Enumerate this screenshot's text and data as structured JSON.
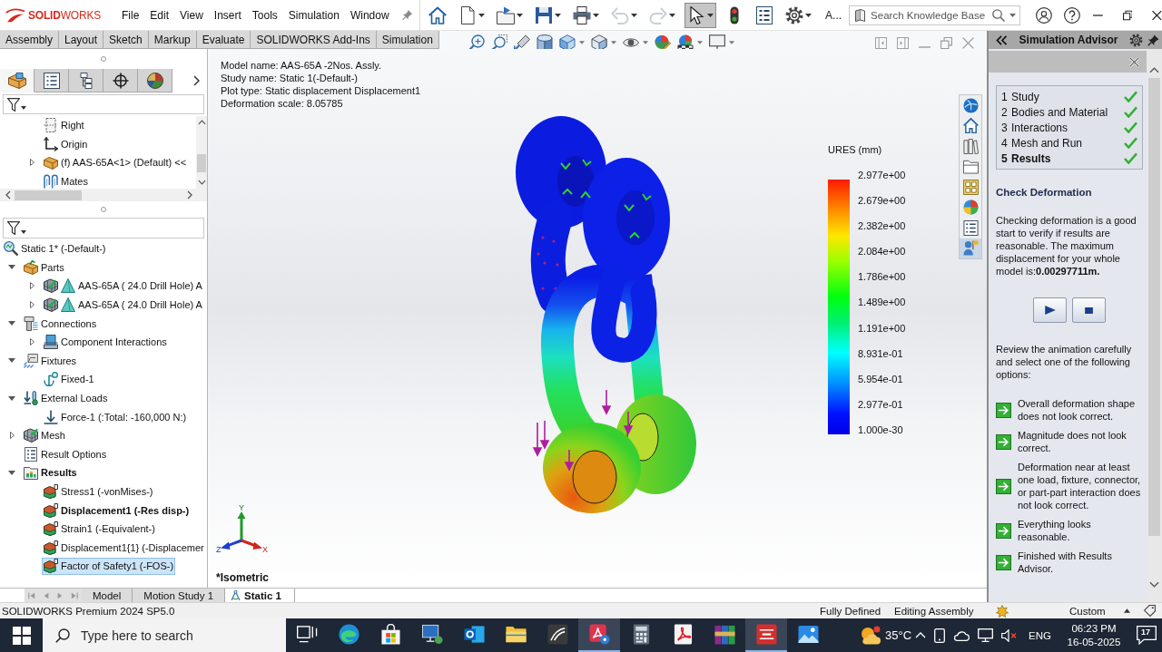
{
  "title_bar": {
    "brand": "**SOLID**WORKS",
    "menus": [
      "File",
      "Edit",
      "View",
      "Insert",
      "Tools",
      "Simulation",
      "Window"
    ],
    "toolbar": [
      {
        "kind": "home",
        "selected": false,
        "disabled": false
      },
      {
        "kind": "new",
        "selected": false,
        "disabled": false
      },
      {
        "kind": "open",
        "selected": false,
        "disabled": false
      },
      {
        "kind": "save",
        "selected": false,
        "disabled": false
      },
      {
        "kind": "print",
        "selected": false,
        "disabled": false
      },
      {
        "kind": "undo",
        "selected": false,
        "disabled": true
      },
      {
        "kind": "redo",
        "selected": false,
        "disabled": true
      },
      {
        "kind": "select",
        "selected": true,
        "disabled": false
      },
      {
        "kind": "rebuild",
        "selected": false,
        "disabled": false
      },
      {
        "kind": "properties",
        "selected": false,
        "disabled": false
      },
      {
        "kind": "options",
        "selected": false,
        "disabled": false
      }
    ],
    "toolbar_label": "A...",
    "search": {
      "placeholder": "Search Knowledge Base"
    }
  },
  "command_tabs": [
    {
      "label": "Assembly",
      "selected": false
    },
    {
      "label": "Layout",
      "selected": false
    },
    {
      "label": "Sketch",
      "selected": false
    },
    {
      "label": "Markup",
      "selected": false
    },
    {
      "label": "Evaluate",
      "selected": false
    },
    {
      "label": "SOLIDWORKS Add-Ins",
      "selected": false
    },
    {
      "label": "Simulation",
      "selected": false
    }
  ],
  "feature_manager": {
    "tabs": [
      {
        "kind": "tree",
        "selected": true
      },
      {
        "kind": "properties",
        "selected": false
      },
      {
        "kind": "configurations",
        "selected": false
      },
      {
        "kind": "dimensions",
        "selected": false
      },
      {
        "kind": "display",
        "selected": false
      }
    ],
    "assembly_tree": [
      {
        "label": "Right",
        "kind": "plane",
        "selected": false
      },
      {
        "label": "Origin",
        "kind": "origin",
        "selected": false
      },
      {
        "label": "(f) AAS-65A<1> (Default) <<",
        "kind": "component",
        "expanded": false,
        "selected": false
      },
      {
        "label": "Mates",
        "kind": "mates",
        "selected": false
      }
    ],
    "study_tree": [
      {
        "label": "Static 1* (-Default-)",
        "kind": "study",
        "bold": false,
        "selected": false,
        "children": [
          {
            "label": "Parts",
            "kind": "parts",
            "expanded": true,
            "bold": false,
            "selected": false,
            "children": [
              {
                "label": "AAS-65A ( 24.0 Drill Hole) A",
                "kind": "body",
                "expanded": false,
                "bold": false,
                "selected": false
              },
              {
                "label": "AAS-65A ( 24.0 Drill Hole) A",
                "kind": "body",
                "expanded": false,
                "bold": false,
                "selected": false
              }
            ]
          },
          {
            "label": "Connections",
            "kind": "connections",
            "expanded": true,
            "bold": false,
            "selected": false,
            "children": [
              {
                "label": "Component Interactions",
                "kind": "interaction",
                "expanded": false,
                "bold": false,
                "selected": false
              }
            ]
          },
          {
            "label": "Fixtures",
            "kind": "fixtures",
            "expanded": true,
            "bold": false,
            "selected": false,
            "children": [
              {
                "label": "Fixed-1",
                "kind": "fixed",
                "bold": false,
                "selected": false
              }
            ]
          },
          {
            "label": "External Loads",
            "kind": "loads",
            "expanded": true,
            "bold": false,
            "selected": false,
            "children": [
              {
                "label": "Force-1 (:Total: -160,000 N:)",
                "kind": "force",
                "bold": false,
                "selected": false
              }
            ]
          },
          {
            "label": "Mesh",
            "kind": "mesh",
            "expanded": false,
            "bold": false,
            "selected": false
          },
          {
            "label": "Result Options",
            "kind": "options",
            "bold": false,
            "selected": false
          },
          {
            "label": "Results",
            "kind": "results",
            "expanded": true,
            "bold": true,
            "selected": false,
            "children": [
              {
                "label": "Stress1 (-vonMises-)",
                "kind": "plot",
                "bold": false,
                "selected": false
              },
              {
                "label": "Displacement1 (-Res disp-)",
                "kind": "plot",
                "bold": true,
                "selected": false
              },
              {
                "label": "Strain1 (-Equivalent-)",
                "kind": "plot",
                "bold": false,
                "selected": false
              },
              {
                "label": "Displacement1{1} (-Displacemer",
                "kind": "plot",
                "bold": false,
                "selected": false
              },
              {
                "label": "Factor of Safety1 (-FOS-)",
                "kind": "plot",
                "bold": false,
                "selected": true
              }
            ]
          }
        ]
      }
    ]
  },
  "viewport": {
    "info": [
      "Model name: AAS-65A -2Nos. Assly.",
      "Study name: Static 1(-Default-)",
      "Plot type: Static displacement Displacement1",
      "Deformation scale: 8.05785"
    ],
    "legend": {
      "title": "URES (mm)",
      "labels": [
        "2.977e+00",
        "2.679e+00",
        "2.382e+00",
        "2.084e+00",
        "1.786e+00",
        "1.489e+00",
        "1.191e+00",
        "8.931e-01",
        "5.954e-01",
        "2.977e-01",
        "1.000e-30"
      ]
    },
    "triad": {
      "x": "X",
      "y": "Y",
      "z": "Z"
    },
    "view_name": "*Isometric",
    "task_pane_tabs": [
      {
        "kind": "resources",
        "selected": false
      },
      {
        "kind": "home",
        "selected": false
      },
      {
        "kind": "library",
        "selected": false
      },
      {
        "kind": "explorer",
        "selected": false
      },
      {
        "kind": "palette",
        "selected": false
      },
      {
        "kind": "appearances",
        "selected": false
      },
      {
        "kind": "properties",
        "selected": false
      },
      {
        "kind": "advisor",
        "selected": true
      }
    ]
  },
  "document_tabs": [
    {
      "label": "Model",
      "kind": "model",
      "selected": false
    },
    {
      "label": "Motion Study 1",
      "kind": "motion",
      "selected": false
    },
    {
      "label": "Static 1",
      "kind": "study",
      "selected": true
    }
  ],
  "advisor": {
    "title": "Simulation Advisor",
    "steps": [
      {
        "number": "1",
        "label": "Study",
        "done": true,
        "current": false
      },
      {
        "number": "2",
        "label": "Bodies and Material",
        "done": true,
        "current": false
      },
      {
        "number": "3",
        "label": "Interactions",
        "done": true,
        "current": false
      },
      {
        "number": "4",
        "label": "Mesh and Run",
        "done": true,
        "current": false
      },
      {
        "number": "5",
        "label": "Results",
        "done": true,
        "current": true
      }
    ],
    "heading": "Check Deformation",
    "intro": "Checking deformation is a good start to verify if results are reasonable. The maximum displacement for your whole model is:**0.00297711m.**",
    "prompt": "Review the animation carefully and select one of the following options:",
    "options": [
      "Overall deformation shape does not look correct.",
      "Magnitude does not look correct.",
      "Deformation near at least one load, fixture, connector, or part-part interaction does not look correct.",
      "Everything looks reasonable.",
      "Finished with Results Advisor."
    ]
  },
  "status_bar": {
    "product": "SOLIDWORKS Premium 2024 SP5.0",
    "state": "Fully Defined",
    "mode": "Editing Assembly",
    "units": "Custom"
  },
  "taskbar": {
    "search": {
      "placeholder": "Type here to search"
    },
    "apps": [
      {
        "kind": "task-view",
        "active": false
      },
      {
        "kind": "browser",
        "active": false
      },
      {
        "kind": "store",
        "active": false
      },
      {
        "kind": "remote",
        "active": false
      },
      {
        "kind": "mail",
        "active": false
      },
      {
        "kind": "files",
        "active": false
      },
      {
        "kind": "curve",
        "active": false
      },
      {
        "kind": "reader",
        "active": true
      },
      {
        "kind": "calculator",
        "active": false
      },
      {
        "kind": "pdf",
        "active": false
      },
      {
        "kind": "archive",
        "active": false
      },
      {
        "kind": "cad",
        "active": true
      },
      {
        "kind": "photos",
        "active": false
      }
    ],
    "weather": "35°C",
    "language": "ENG",
    "time": "06:23 PM",
    "date": "16-05-2025",
    "notifications": "17"
  }
}
